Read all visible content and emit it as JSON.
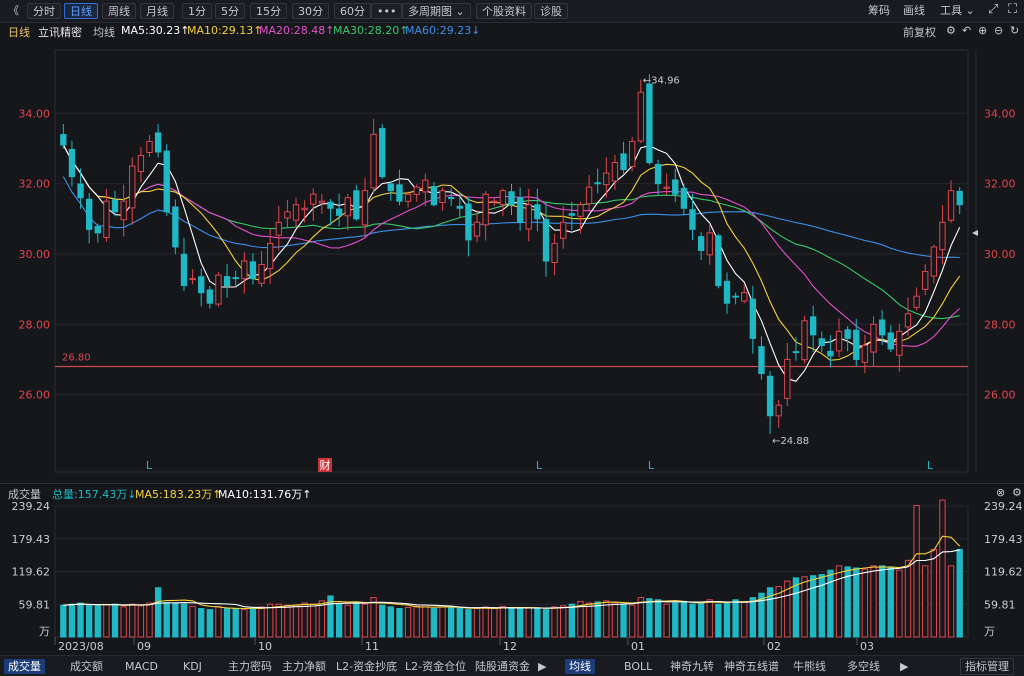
{
  "toolbar": {
    "back_icon": "《",
    "left": [
      "分时",
      "日线",
      "周线",
      "月线",
      "1分",
      "5分",
      "15分",
      "30分",
      "60分",
      "•••",
      "多周期图 ⌄",
      "个股资料",
      "诊股"
    ],
    "active_index": 1,
    "right": [
      "筹码",
      "画线",
      "工具 ⌄"
    ]
  },
  "info": {
    "period": "日线",
    "stock_name": "立讯精密",
    "ma_label": "均线",
    "ma5": "MA5:30.23↑",
    "ma10": "MA10:29.13↑",
    "ma20": "MA20:28.48↑",
    "ma30": "MA30:28.20↑",
    "ma60": "MA60:29.23↓",
    "adjust": "前复权"
  },
  "colors": {
    "up": "#e0454c",
    "down": "#1fb8c4",
    "ma5": "#ffffff",
    "ma10": "#f2d13a",
    "ma20": "#e64fd0",
    "ma30": "#39c96a",
    "ma60": "#3a8fe8",
    "line": "#c94a4a"
  },
  "price_axis": {
    "ticks": [
      "34.00",
      "32.00",
      "30.00",
      "28.00",
      "26.00"
    ],
    "high_label": "←34.96",
    "low_label": "←24.88",
    "hline_label": "26.80",
    "markers": [
      "L",
      "财",
      "L",
      "L",
      "L"
    ]
  },
  "volume": {
    "title": "成交量",
    "total": "总量:157.43万↓",
    "ma5": "MA5:183.23万↑",
    "ma10": "MA10:131.76万↑",
    "ticks": [
      "239.24",
      "179.43",
      "119.62",
      "59.81",
      "万"
    ],
    "x_labels": [
      "2023/08",
      "09",
      "10",
      "11",
      "12",
      "01",
      "02",
      "03"
    ]
  },
  "bottom_left": [
    "成交量",
    "成交额",
    "MACD",
    "KDJ",
    "主力密码",
    "主力净额",
    "L2-资金抄底",
    "L2-资金仓位",
    "陆股通资金"
  ],
  "bottom_right": [
    "均线",
    "BOLL",
    "神奇九转",
    "神奇五线谱",
    "牛熊线",
    "多空线"
  ],
  "bottom_manage": "指标管理",
  "chart_data": {
    "type": "candlestick",
    "series_note": "daily K-line with MA5/MA10/MA20/MA30/MA60 and volume",
    "ylim": [
      23.8,
      35.8
    ],
    "hline": 26.8,
    "high": 34.96,
    "low": 24.88,
    "closes": [
      33.1,
      32.2,
      31.6,
      30.7,
      30.6,
      31.5,
      31.2,
      31.5,
      32.5,
      32.8,
      33.2,
      32.9,
      31.2,
      30.2,
      29.1,
      29.3,
      28.9,
      28.6,
      29.4,
      29.1,
      29.3,
      29.8,
      29.3,
      29.7,
      30.3,
      30.9,
      31.2,
      31.4,
      31.3,
      31.7,
      31.5,
      31.3,
      31.1,
      31.6,
      31.0,
      31.8,
      33.4,
      32.2,
      31.8,
      31.5,
      31.7,
      31.9,
      32.1,
      31.4,
      31.8,
      31.6,
      31.3,
      30.4,
      30.9,
      31.7,
      31.5,
      31.8,
      31.4,
      30.9,
      31.4,
      31.0,
      29.8,
      30.3,
      30.9,
      31.1,
      31.4,
      31.9,
      32.0,
      32.3,
      32.6,
      32.4,
      33.2,
      34.6,
      32.6,
      32.0,
      31.9,
      31.7,
      31.3,
      30.7,
      30.1,
      30.6,
      29.1,
      28.6,
      28.8,
      28.9,
      27.6,
      26.6,
      25.4,
      25.7,
      27.0,
      27.2,
      28.1,
      27.7,
      27.4,
      27.1,
      27.8,
      27.6,
      27.0,
      27.4,
      28.0,
      27.7,
      27.3,
      27.8,
      28.3,
      28.8,
      29.5,
      30.2,
      30.9,
      31.8,
      31.4
    ],
    "volumes": [
      58,
      60,
      62,
      58,
      57,
      59,
      60,
      55,
      60,
      57,
      62,
      90,
      63,
      62,
      60,
      56,
      52,
      50,
      56,
      52,
      52,
      50,
      52,
      55,
      60,
      60,
      58,
      58,
      62,
      60,
      66,
      75,
      60,
      58,
      62,
      60,
      72,
      58,
      55,
      52,
      54,
      56,
      58,
      52,
      55,
      54,
      52,
      50,
      52,
      55,
      52,
      56,
      54,
      52,
      54,
      52,
      50,
      55,
      57,
      60,
      65,
      62,
      64,
      66,
      62,
      60,
      58,
      72,
      70,
      68,
      60,
      62,
      65,
      60,
      64,
      68,
      60,
      62,
      68,
      64,
      72,
      80,
      90,
      92,
      102,
      108,
      110,
      112,
      114,
      122,
      130,
      128,
      126,
      124,
      130,
      130,
      128,
      122,
      140,
      240,
      130,
      160,
      250,
      130,
      160
    ],
    "ma5_vol": 183.23,
    "ma10_vol": 131.76,
    "total_vol": 157.43
  }
}
